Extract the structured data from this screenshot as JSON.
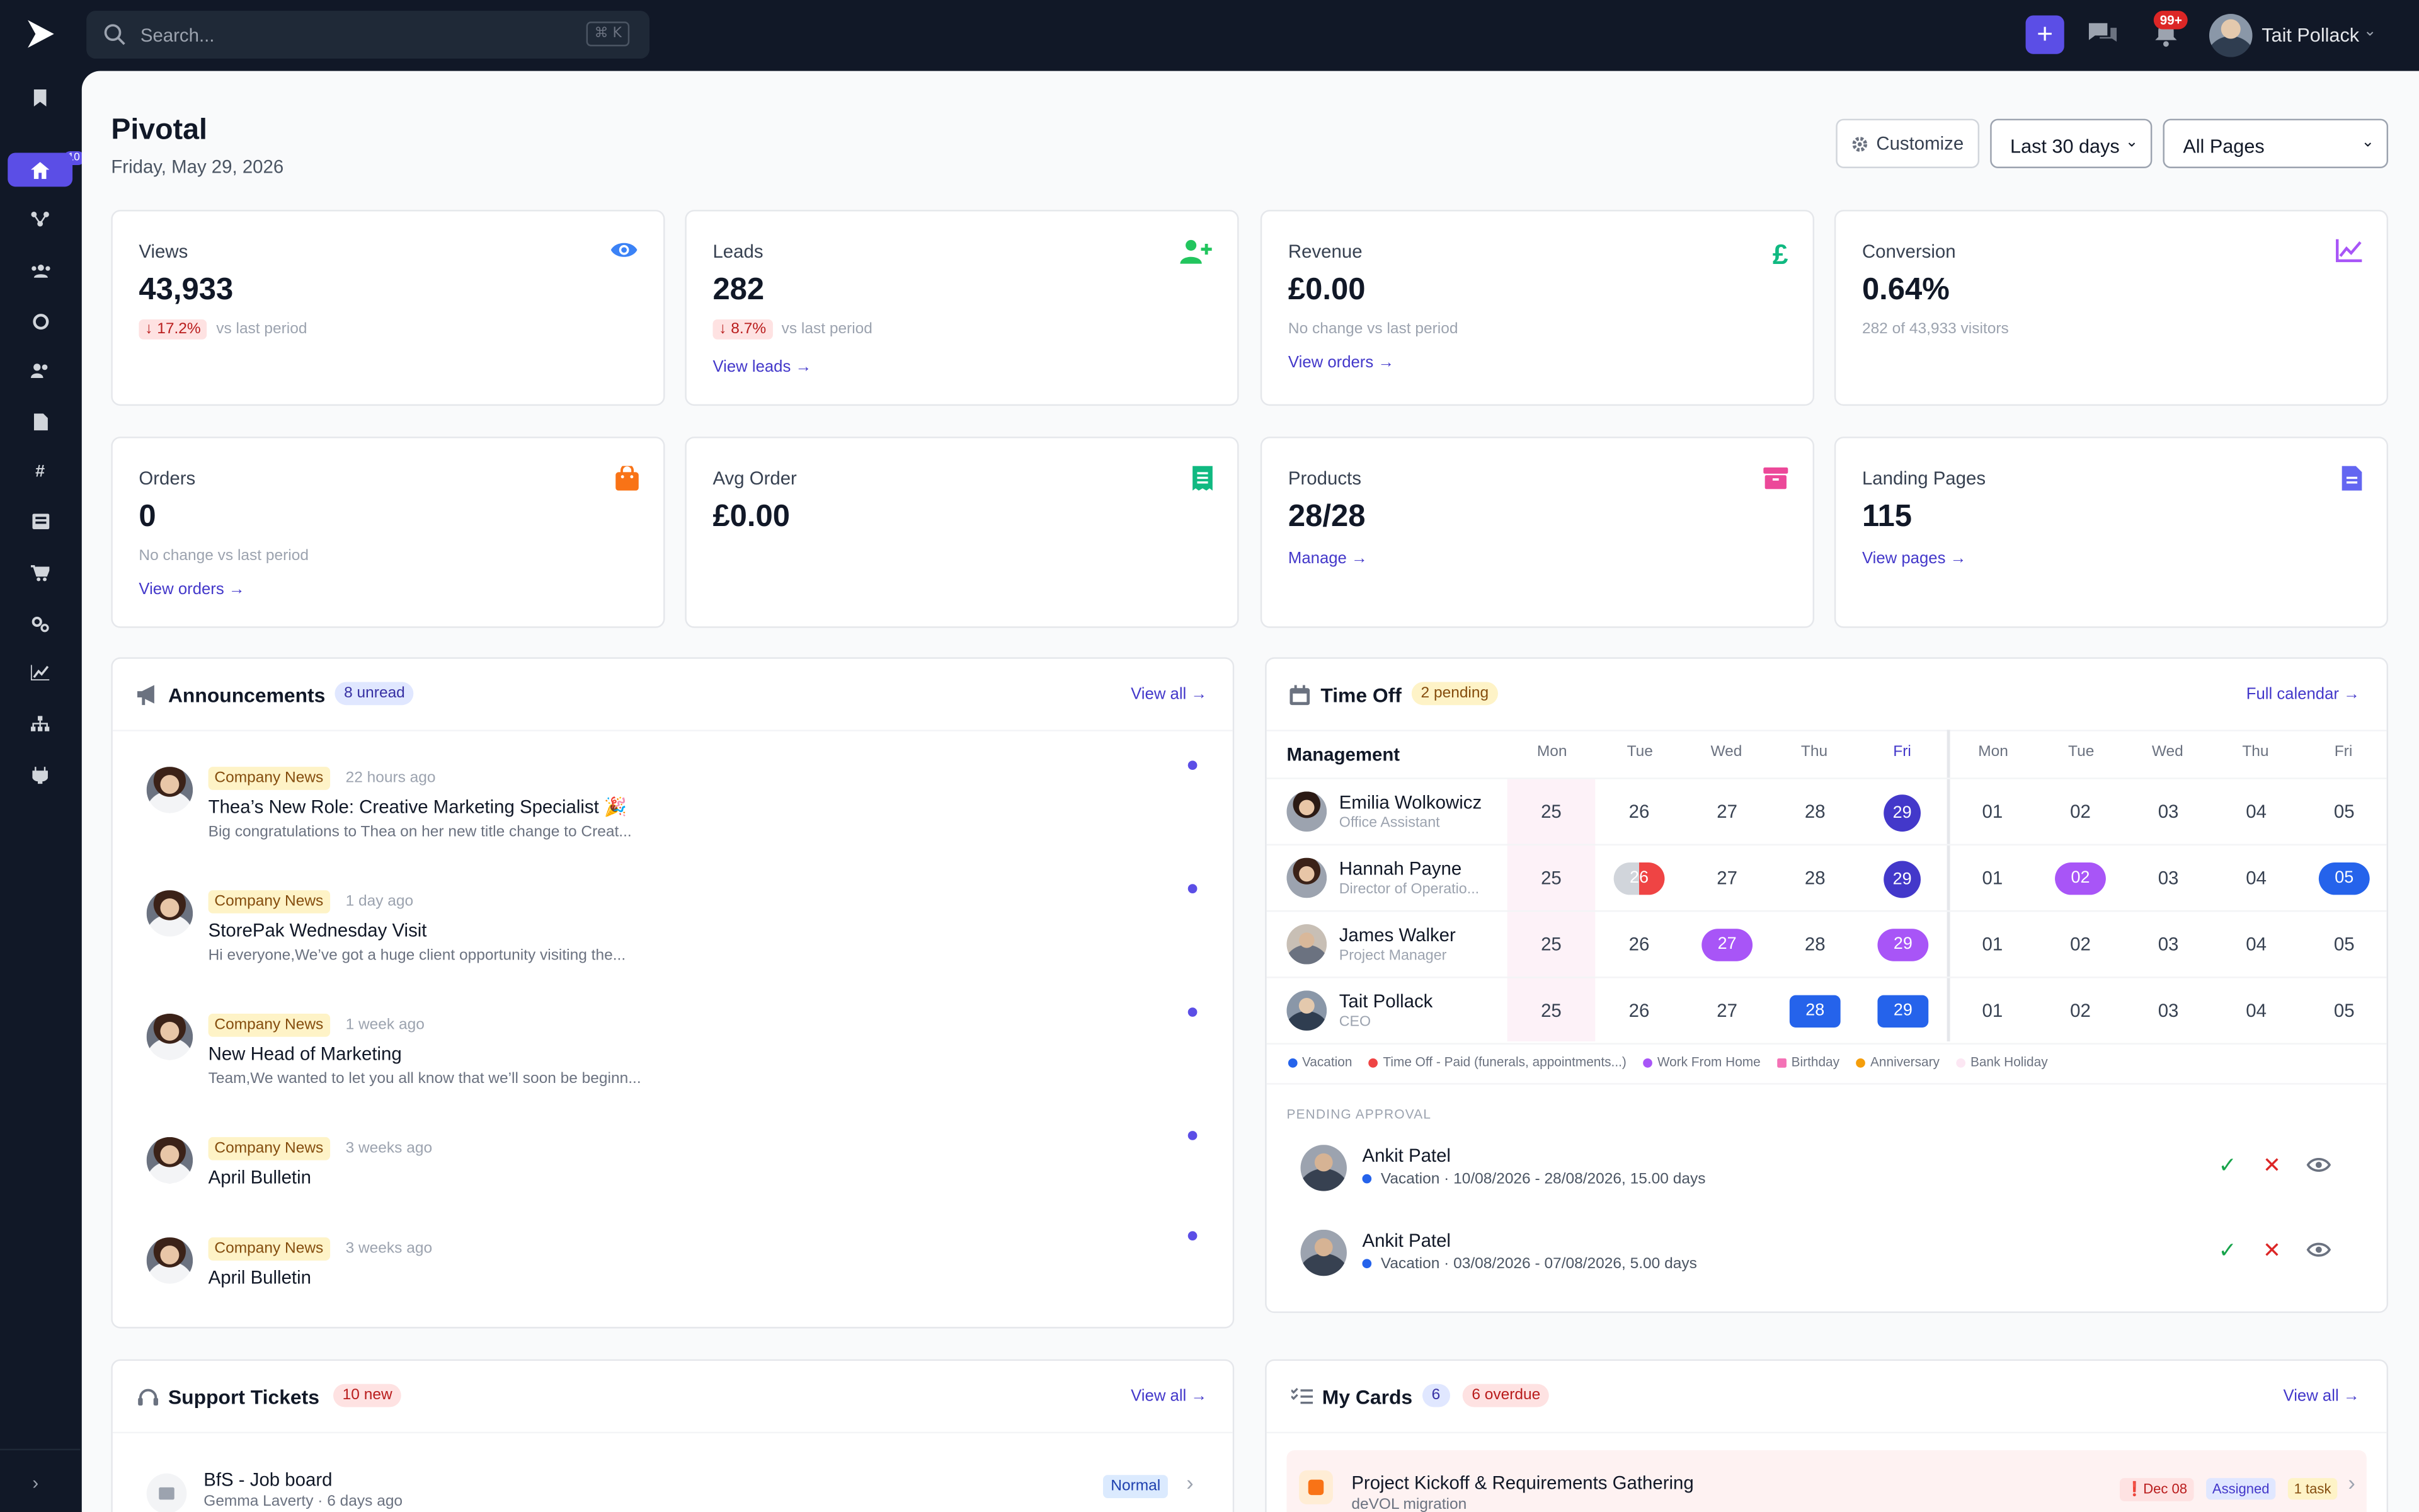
{
  "search": {
    "placeholder": "Search...",
    "shortcut": "⌘ K"
  },
  "topbar": {
    "user_name": "Tait Pollack",
    "notif_count": "99+"
  },
  "sidebar": {
    "badge": "10",
    "items": [
      "bookmark-icon",
      "home-icon",
      "workflow-icon",
      "team-icon",
      "support-icon",
      "users-icon",
      "document-icon",
      "hashtag-icon",
      "news-icon",
      "cart-icon",
      "settings-icon",
      "analytics-icon",
      "org-chart-icon",
      "plug-icon"
    ]
  },
  "page": {
    "title": "Pivotal",
    "date": "Friday, May 29, 2026",
    "customize": "Customize",
    "period": "Last 30 days",
    "pages": "All Pages"
  },
  "stats": [
    {
      "label": "Views",
      "value": "43,933",
      "change": "↓ 17.2%",
      "change_note": "vs last period",
      "color": "#3b82f6"
    },
    {
      "label": "Leads",
      "value": "282",
      "change": "↓ 8.7%",
      "change_note": "vs last period",
      "link": "View leads →",
      "color": "#22c55e"
    },
    {
      "label": "Revenue",
      "value": "£0.00",
      "sub": "No change vs last period",
      "link": "View orders →",
      "color": "#10b981"
    },
    {
      "label": "Conversion",
      "value": "0.64%",
      "sub": "282 of 43,933 visitors",
      "color": "#a855f7"
    },
    {
      "label": "Orders",
      "value": "0",
      "sub": "No change vs last period",
      "link": "View orders →",
      "color": "#f97316"
    },
    {
      "label": "Avg Order",
      "value": "£0.00",
      "color": "#10b981"
    },
    {
      "label": "Products",
      "value": "28/28",
      "link": "Manage →",
      "color": "#ec4899"
    },
    {
      "label": "Landing Pages",
      "value": "115",
      "link": "View pages →",
      "color": "#6366f1"
    }
  ],
  "announcements": {
    "title": "Announcements",
    "unread": "8 unread",
    "view_all": "View all",
    "items": [
      {
        "tag": "Company News",
        "when": "22 hours ago",
        "title": "Thea’s New Role: Creative Marketing Specialist 🎉",
        "desc": "Big congratulations to Thea on her new title change to Creat..."
      },
      {
        "tag": "Company News",
        "when": "1 day ago",
        "title": "StorePak Wednesday Visit",
        "desc": "Hi everyone,We’ve got a huge client opportunity visiting the..."
      },
      {
        "tag": "Company News",
        "when": "1 week ago",
        "title": "New Head of Marketing",
        "desc": "Team,We wanted to let you all know that we’ll soon be beginn..."
      },
      {
        "tag": "Company News",
        "when": "3 weeks ago",
        "title": "April Bulletin",
        "desc": ""
      },
      {
        "tag": "Company News",
        "when": "3 weeks ago",
        "title": "April Bulletin",
        "desc": ""
      }
    ]
  },
  "timeoff": {
    "title": "Time Off",
    "pending": "2 pending",
    "full_calendar": "Full calendar",
    "group": "Management",
    "days": [
      "Mon",
      "Tue",
      "Wed",
      "Thu",
      "Fri",
      "Mon",
      "Tue",
      "Wed",
      "Thu",
      "Fri"
    ],
    "dates": [
      "25",
      "26",
      "27",
      "28",
      "29",
      "01",
      "02",
      "03",
      "04",
      "05"
    ],
    "people": [
      {
        "name": "Emilia Wolkowicz",
        "role": "Office Assistant"
      },
      {
        "name": "Hannah Payne",
        "role": "Director of Operatio..."
      },
      {
        "name": "James Walker",
        "role": "Project Manager"
      },
      {
        "name": "Tait Pollack",
        "role": "CEO"
      }
    ],
    "legend": [
      "Vacation",
      "Time Off - Paid (funerals, appointments...)",
      "Work From Home",
      "Birthday",
      "Anniversary",
      "Bank Holiday"
    ],
    "colors": {
      "vacation": "#2563eb",
      "paid": "#ef4444",
      "wfh": "#a855f7",
      "today": "#4f46e5",
      "bank": "#fce7f3"
    },
    "pending_label": "PENDING APPROVAL",
    "requests": [
      {
        "name": "Ankit Patel",
        "detail": "Vacation · 10/08/2026 - 28/08/2026, 15.00 days"
      },
      {
        "name": "Ankit Patel",
        "detail": "Vacation · 03/08/2026 - 07/08/2026, 5.00 days"
      }
    ]
  },
  "support": {
    "title": "Support Tickets",
    "new": "10 new",
    "view_all": "View all",
    "ticket": {
      "title": "BfS - Job board",
      "meta": "Gemma Laverty · 6 days ago",
      "priority": "Normal"
    }
  },
  "cards": {
    "title": "My Cards",
    "count": "6",
    "overdue": "6 overdue",
    "view_all": "View all",
    "card": {
      "title": "Project Kickoff & Requirements Gathering",
      "sub": "deVOL migration",
      "due": "Dec 08",
      "status": "Assigned",
      "tasks": "1 task"
    }
  }
}
